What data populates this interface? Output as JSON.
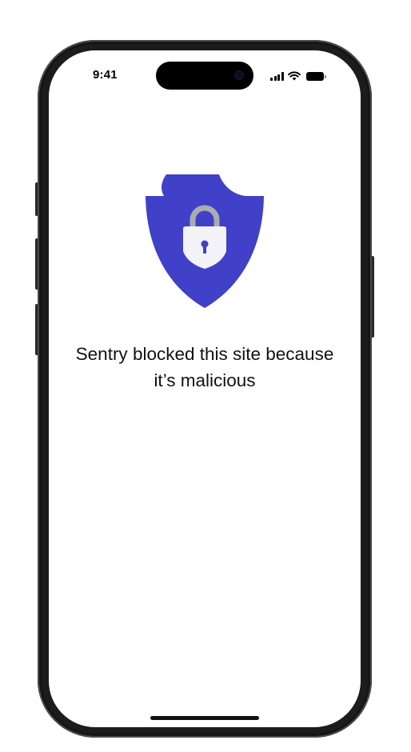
{
  "status_bar": {
    "time": "9:41",
    "signal_icon": "cellular-signal-icon",
    "wifi_icon": "wifi-icon",
    "battery_icon": "battery-icon"
  },
  "hero": {
    "icon": "shield-lock-icon",
    "shield_color": "#4040C8",
    "lock_body_color": "#F2F2F7",
    "lock_shackle_color": "#ABABB0"
  },
  "message": {
    "brand": "Sentry",
    "text_line1": " blocked this site because",
    "text_line2": "it’s malicious"
  }
}
